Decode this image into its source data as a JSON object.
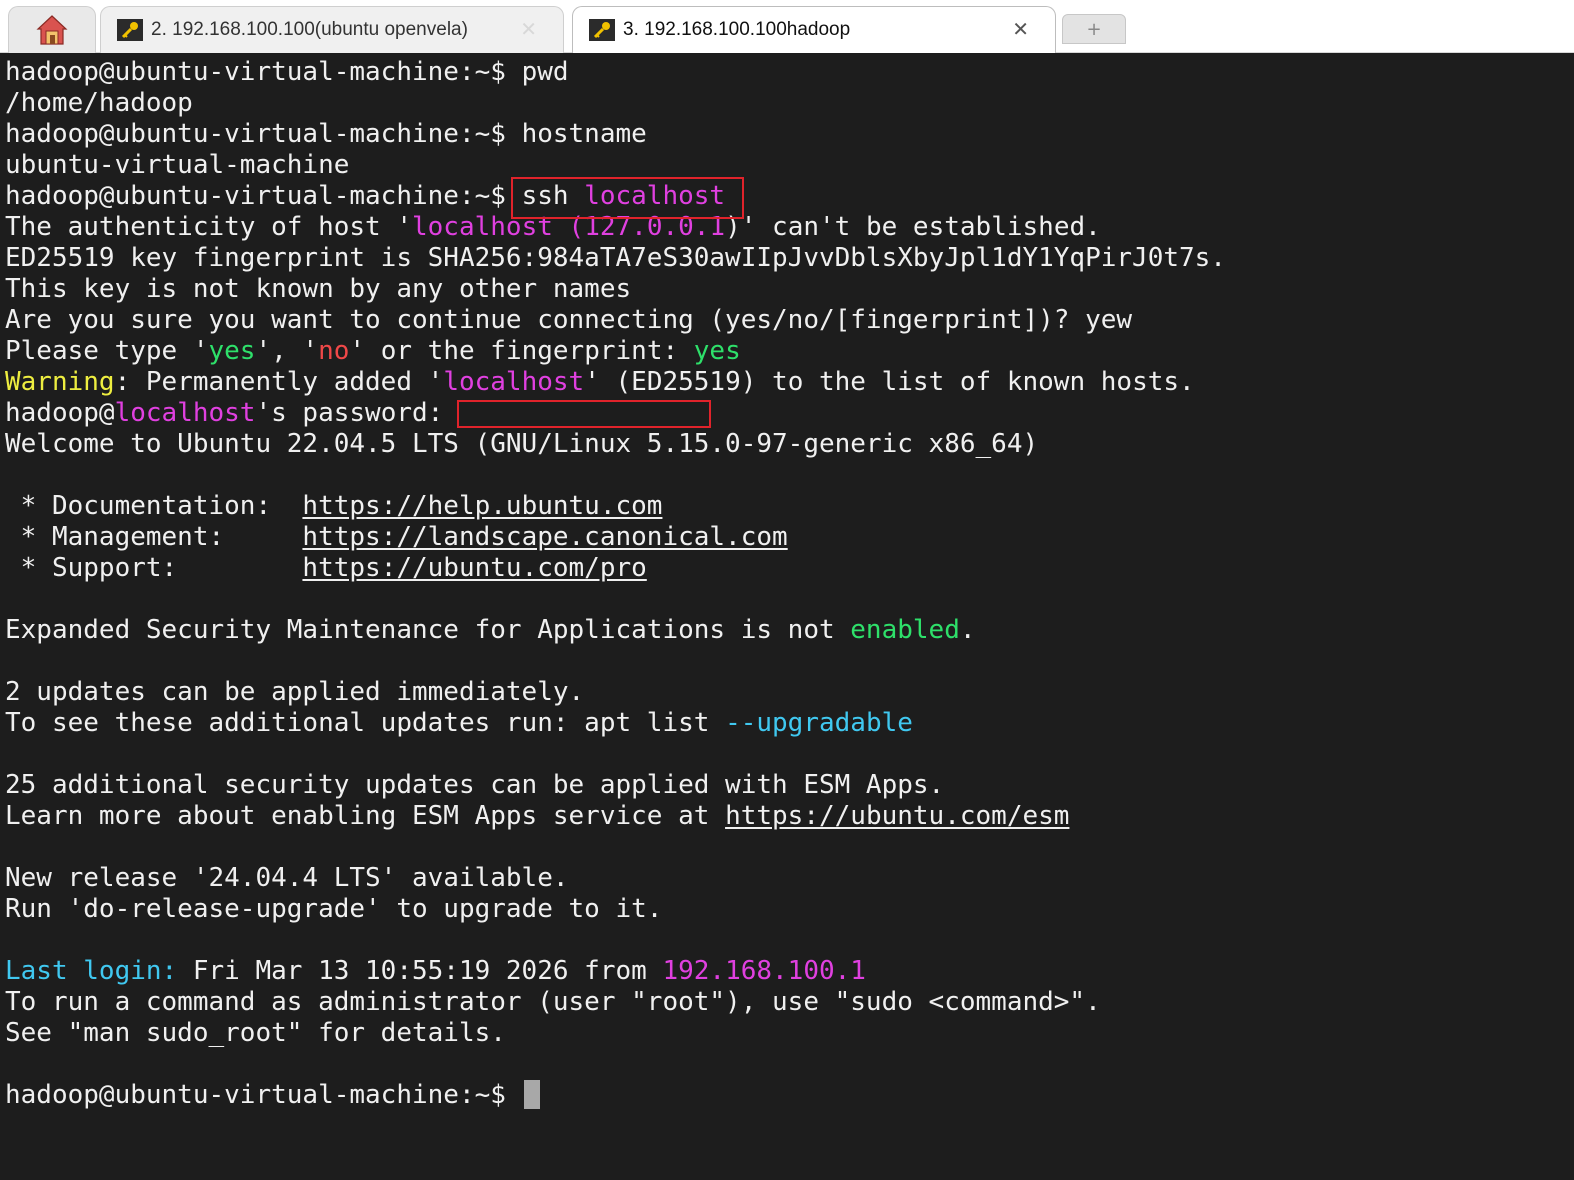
{
  "tabs": [
    {
      "title": "2. 192.168.100.100(ubuntu openvela)",
      "close": "✕",
      "active": false
    },
    {
      "title": "3. 192.168.100.100hadoop",
      "close": "✕",
      "active": true
    }
  ],
  "new_tab_label": "+",
  "colors": {
    "background": "#1d1d1d",
    "magenta": "#e040e0",
    "green": "#2ee06a",
    "red": "#f04848",
    "yellow": "#eeee40",
    "cyan": "#40c8f0",
    "highlight_box": "#e0232b"
  },
  "terminal": {
    "prompt": "hadoop@ubuntu-virtual-machine:~$",
    "cmd_pwd": "pwd",
    "out_pwd": "/home/hadoop",
    "cmd_hostname": "hostname",
    "out_hostname": "ubuntu-virtual-machine",
    "cmd_ssh": "ssh",
    "localhost": "localhost",
    "auth_a": "The authenticity of host '",
    "auth_ip": "(127.0.0.1",
    "auth_b": ")' can't be established.",
    "fingerprint": "ED25519 key fingerprint is SHA256:984aTA7eS30awIIpJvvDblsXbyJpl1dY1YqPirJ0t7s.",
    "not_known": "This key is not known by any other names",
    "are_you_sure": "Are you sure you want to continue connecting (yes/no/[fingerprint])? yew",
    "please_a": "Please type '",
    "yes": "yes",
    "please_b": "', '",
    "no": "no",
    "please_c": "' or the fingerprint: ",
    "warning": "Warning",
    "perm_a": ": Permanently added '",
    "perm_b": "' (ED25519) to the list of known hosts.",
    "pw_user": "hadoop@",
    "pw_rest": "'s password:",
    "welcome": "Welcome to Ubuntu 22.04.5 LTS (GNU/Linux 5.15.0-97-generic x86_64)",
    "doc_label": " * Documentation:  ",
    "doc_url": "https://help.ubuntu.com",
    "mgmt_label": " * Management:     ",
    "mgmt_url": "https://landscape.canonical.com",
    "support_label": " * Support:        ",
    "support_url": "https://ubuntu.com/pro",
    "esm_a": "Expanded Security Maintenance for Applications is not ",
    "esm_enabled": "enabled",
    "esm_b": ".",
    "updates": "2 updates can be applied immediately.",
    "see_updates": "To see these additional updates run: apt list ",
    "upgradable": "--upgradable",
    "security_updates": "25 additional security updates can be applied with ESM Apps.",
    "learn_more": "Learn more about enabling ESM Apps service at ",
    "esm_url": "https://ubuntu.com/esm",
    "new_release": "New release '24.04.4 LTS' available.",
    "run_upgrade": "Run 'do-release-upgrade' to upgrade to it.",
    "last_login_label": "Last login:",
    "last_login_text": " Fri Mar 13 10:55:19 2026 from ",
    "last_login_ip": "192.168.100.1",
    "admin_note": "To run a command as administrator (user \"root\"), use \"sudo <command>\".",
    "man_note": "See \"man sudo_root\" for details."
  }
}
